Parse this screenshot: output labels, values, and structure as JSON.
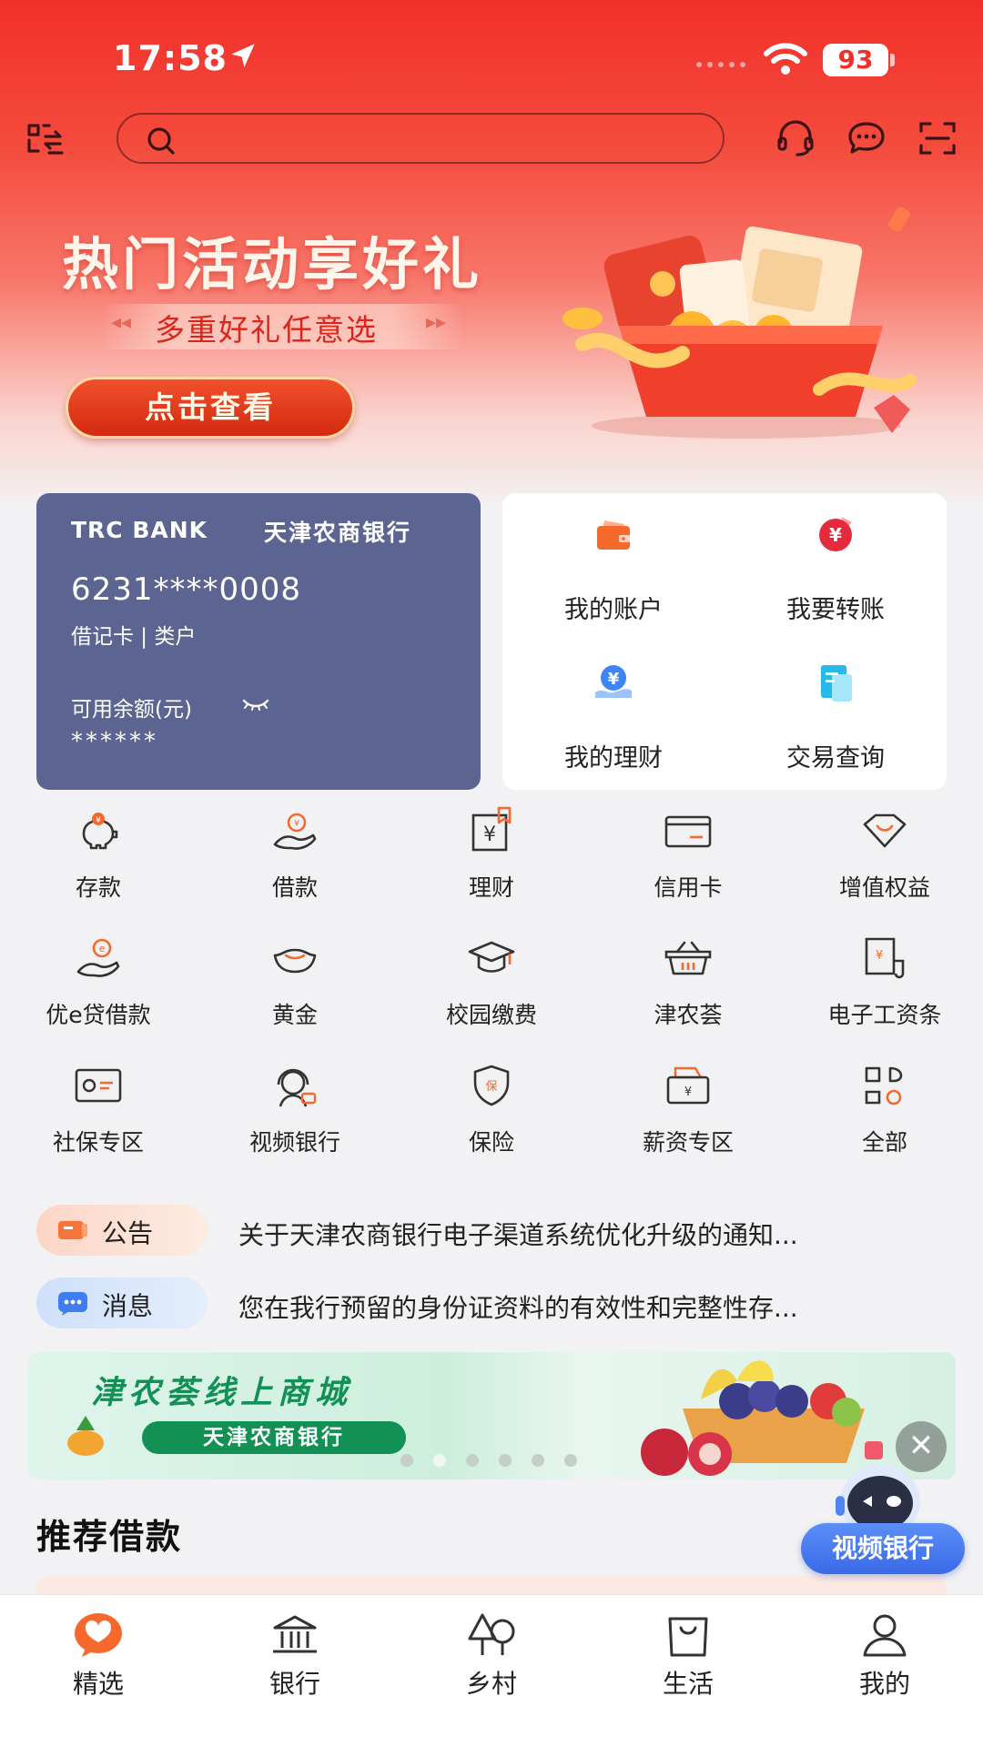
{
  "status_bar": {
    "time": "17:58",
    "battery": "93"
  },
  "banner": {
    "title": "热门活动享好礼",
    "subtitle": "多重好礼任意选",
    "button_label": "点击查看"
  },
  "account_card": {
    "bank_logo_text": "TRC BANK",
    "bank_name": "天津农商银行",
    "card_number": "6231****0008",
    "card_type": "借记卡 | 类户",
    "balance_label": "可用余额(元)",
    "balance_value": "******"
  },
  "quick_actions": [
    {
      "label": "我的账户",
      "icon": "wallet-icon"
    },
    {
      "label": "我要转账",
      "icon": "transfer-icon"
    },
    {
      "label": "我的理财",
      "icon": "wealth-icon"
    },
    {
      "label": "交易查询",
      "icon": "query-icon"
    }
  ],
  "services": [
    {
      "label": "存款",
      "icon": "piggy-bank-icon"
    },
    {
      "label": "借款",
      "icon": "loan-icon"
    },
    {
      "label": "理财",
      "icon": "finance-icon"
    },
    {
      "label": "信用卡",
      "icon": "credit-card-icon"
    },
    {
      "label": "增值权益",
      "icon": "diamond-icon"
    },
    {
      "label": "优e贷借款",
      "icon": "e-loan-icon"
    },
    {
      "label": "黄金",
      "icon": "gold-icon"
    },
    {
      "label": "校园缴费",
      "icon": "graduation-cap-icon"
    },
    {
      "label": "津农荟",
      "icon": "basket-icon"
    },
    {
      "label": "电子工资条",
      "icon": "payslip-icon"
    },
    {
      "label": "社保专区",
      "icon": "social-security-card-icon"
    },
    {
      "label": "视频银行",
      "icon": "video-agent-icon"
    },
    {
      "label": "保险",
      "icon": "shield-icon"
    },
    {
      "label": "薪资专区",
      "icon": "salary-envelope-icon"
    },
    {
      "label": "全部",
      "icon": "all-apps-icon"
    }
  ],
  "notices": [
    {
      "tag": "公告",
      "text": "关于天津农商银行电子渠道系统优化升级的通知..."
    },
    {
      "tag": "消息",
      "text": "您在我行预留的身份证资料的有效性和完整性存..."
    }
  ],
  "promo": {
    "title": "津农荟线上商城",
    "subtitle": "天津农商银行",
    "slides": 6,
    "active_slide": 2
  },
  "recommend": {
    "title": "推荐借款"
  },
  "floating": {
    "label": "视频银行",
    "close": "✕"
  },
  "bottom_nav": [
    {
      "label": "精选",
      "icon": "heart-bubble-icon",
      "active": true
    },
    {
      "label": "银行",
      "icon": "bank-building-icon"
    },
    {
      "label": "乡村",
      "icon": "tree-icon"
    },
    {
      "label": "生活",
      "icon": "shopping-bag-icon"
    },
    {
      "label": "我的",
      "icon": "user-icon"
    }
  ],
  "colors": {
    "brand_red": "#f2302b",
    "card_blue": "#5c6592",
    "accent_orange": "#f56a2c",
    "promo_green": "#139155"
  }
}
